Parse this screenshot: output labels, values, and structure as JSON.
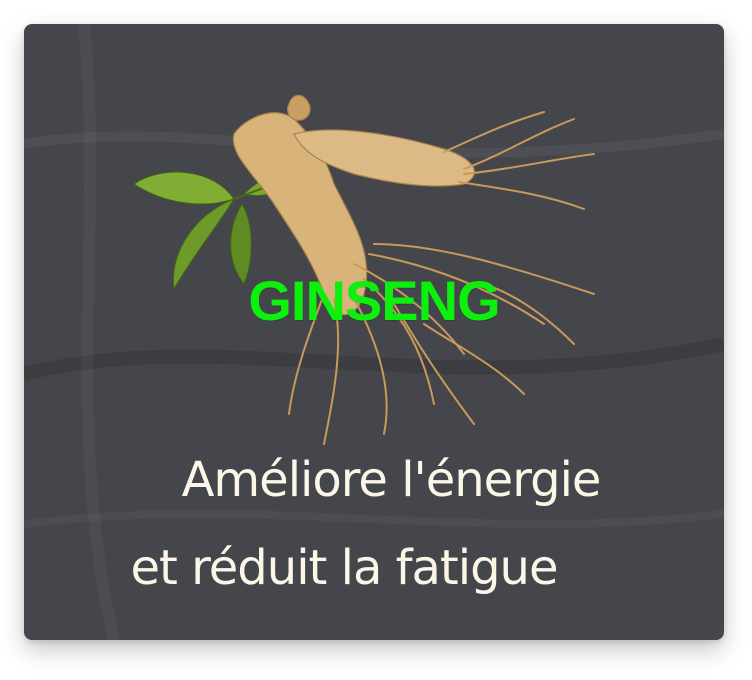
{
  "card": {
    "background_color": "#44464b",
    "image_icon": "ginseng-root-with-leaves-icon",
    "product_name": "GINSENG",
    "product_name_color": "#0df00d",
    "benefit_line_1": "Améliore l'énergie",
    "benefit_line_2": "et réduit la fatigue",
    "benefit_text_color": "#fbf6e6"
  }
}
